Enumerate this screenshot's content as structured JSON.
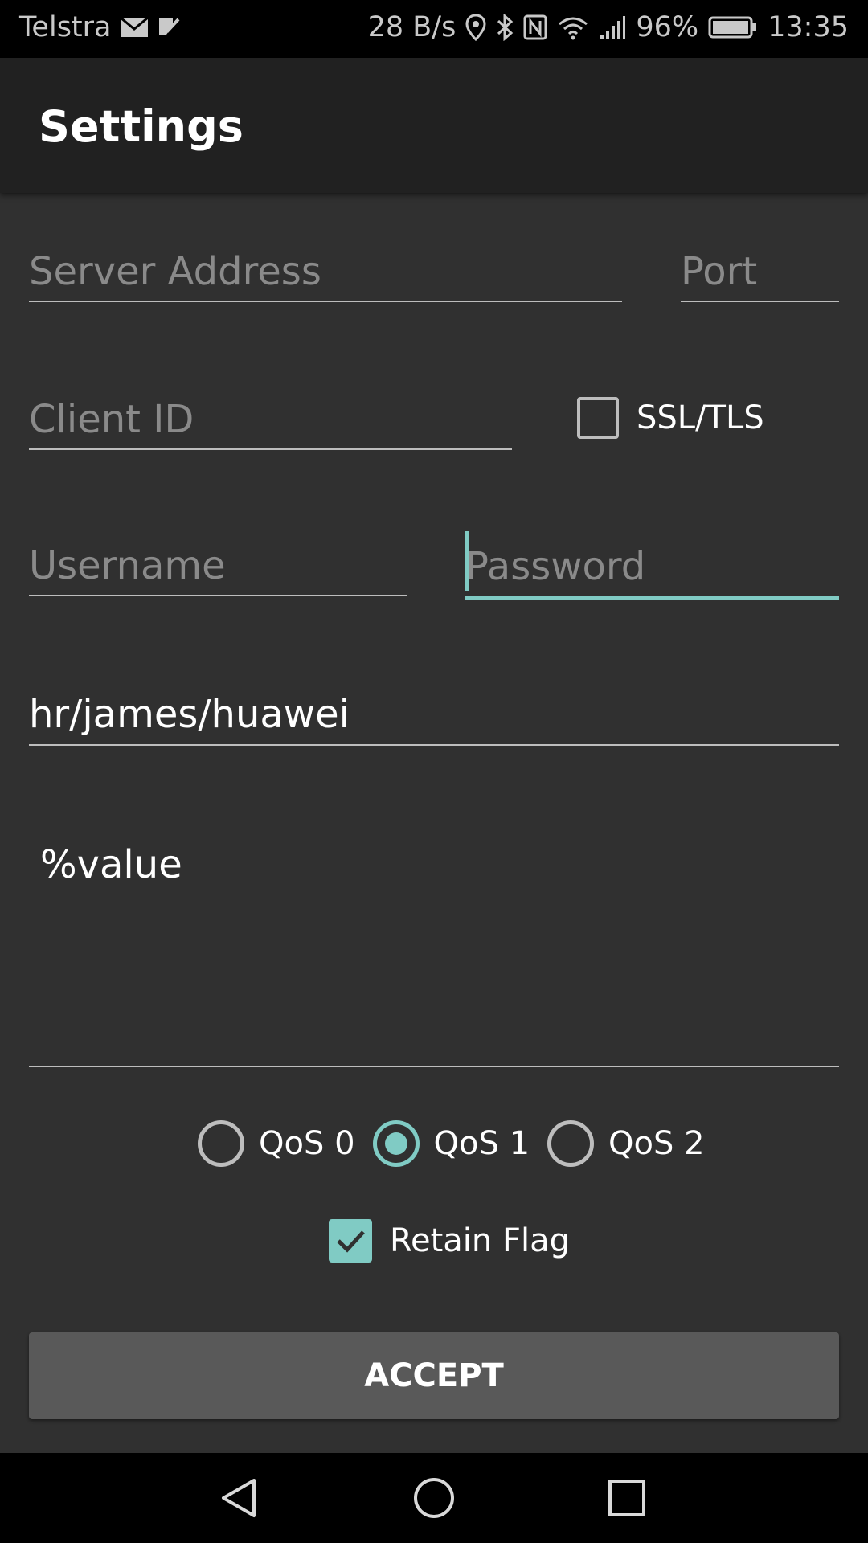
{
  "status_bar": {
    "carrier": "Telstra",
    "net_speed": "28 B/s",
    "battery": "96%",
    "time": "13:35"
  },
  "app_bar": {
    "title": "Settings"
  },
  "form": {
    "server_address": {
      "placeholder": "Server Address",
      "value": ""
    },
    "port": {
      "placeholder": "Port",
      "value": ""
    },
    "client_id": {
      "placeholder": "Client ID",
      "value": ""
    },
    "ssl": {
      "label": "SSL/TLS",
      "checked": false
    },
    "username": {
      "placeholder": "Username",
      "value": ""
    },
    "password": {
      "placeholder": "Password",
      "value": ""
    },
    "topic": {
      "value": "hr/james/huawei"
    },
    "message": {
      "value": "%value"
    },
    "qos": {
      "options": [
        "QoS 0",
        "QoS 1",
        "QoS 2"
      ],
      "selected": "QoS 1"
    },
    "retain": {
      "label": "Retain Flag",
      "checked": true
    },
    "accept_label": "ACCEPT"
  },
  "colors": {
    "accent": "#80cbc4",
    "background": "#303030",
    "app_bar": "#212121",
    "button": "#595959"
  },
  "icons": [
    "mail-icon",
    "check-notification-icon",
    "location-icon",
    "bluetooth-icon",
    "nfc-icon",
    "wifi-icon",
    "signal-icon",
    "battery-icon",
    "back-icon",
    "home-icon",
    "recents-icon"
  ]
}
